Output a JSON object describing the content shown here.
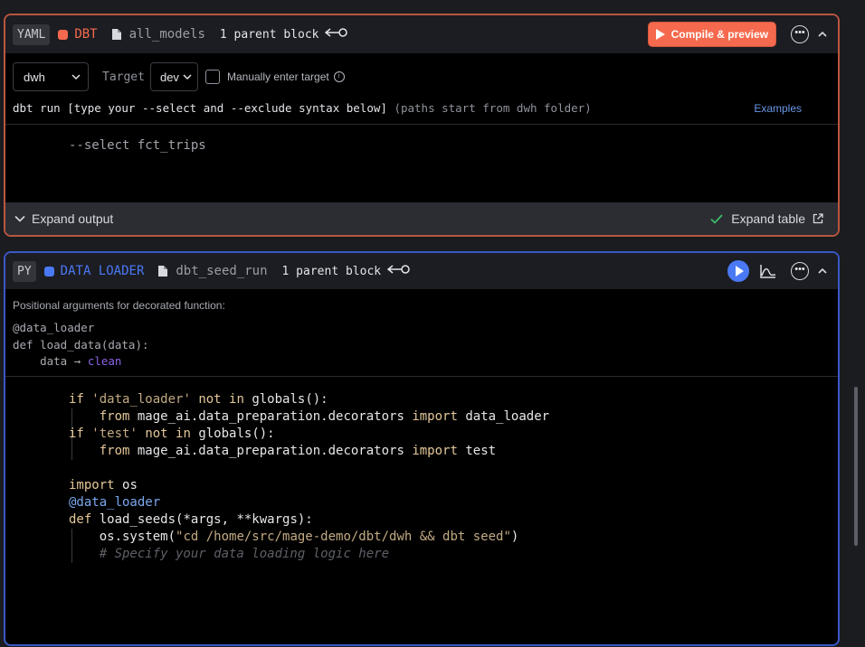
{
  "dbt_block": {
    "language": "YAML",
    "type_label": "DBT",
    "type_color": "#f56a4e",
    "uuid": "all_models",
    "parent_label": "1 parent block",
    "compile_button": "Compile & preview",
    "profile_select": "dwh",
    "target_label": "Target",
    "target_select": "dev",
    "manual_target_label": "Manually enter target",
    "command_prefix": "dbt run [type your --select and --exclude syntax below]",
    "command_hint": "(paths start from dwh folder)",
    "examples_link": "Examples",
    "code": "--select fct_trips",
    "expand_output": "Expand output",
    "expand_table": "Expand table"
  },
  "loader_block": {
    "language": "PY",
    "type_label": "DATA LOADER",
    "type_color": "#4a79f5",
    "uuid": "dbt_seed_run",
    "parent_label": "1 parent block",
    "args_title": "Positional arguments for decorated function:",
    "args_decorator": "@data_loader",
    "args_def": "def load_data(data):",
    "args_param": "data",
    "args_arrow": "→",
    "args_source": "clean",
    "code_lines": {
      "l1_kw": "if",
      "l1_str": "'data_loader'",
      "l1_rest": "not in globals():",
      "l2_from": "from",
      "l2_mod": "mage_ai.data_preparation.decorators",
      "l2_import": "import",
      "l2_name": "data_loader",
      "l3_kw": "if",
      "l3_str": "'test'",
      "l3_rest": "not in globals():",
      "l4_from": "from",
      "l4_mod": "mage_ai.data_preparation.decorators",
      "l4_import": "import",
      "l4_name": "test",
      "l6_import": "import",
      "l6_name": "os",
      "l7_deco": "@data_loader",
      "l8_def": "def",
      "l8_sig": "load_seeds(*args, **kwargs):",
      "l9_call": "os.system(",
      "l9_str": "\"cd /home/src/mage-demo/dbt/dwh && dbt seed\"",
      "l9_close": ")",
      "l10_comment": "# Specify your data loading logic here"
    }
  },
  "colors": {
    "dbt_border": "#b9563f",
    "loader_border": "#3a58c6",
    "accent_blue": "#4a79f5"
  }
}
